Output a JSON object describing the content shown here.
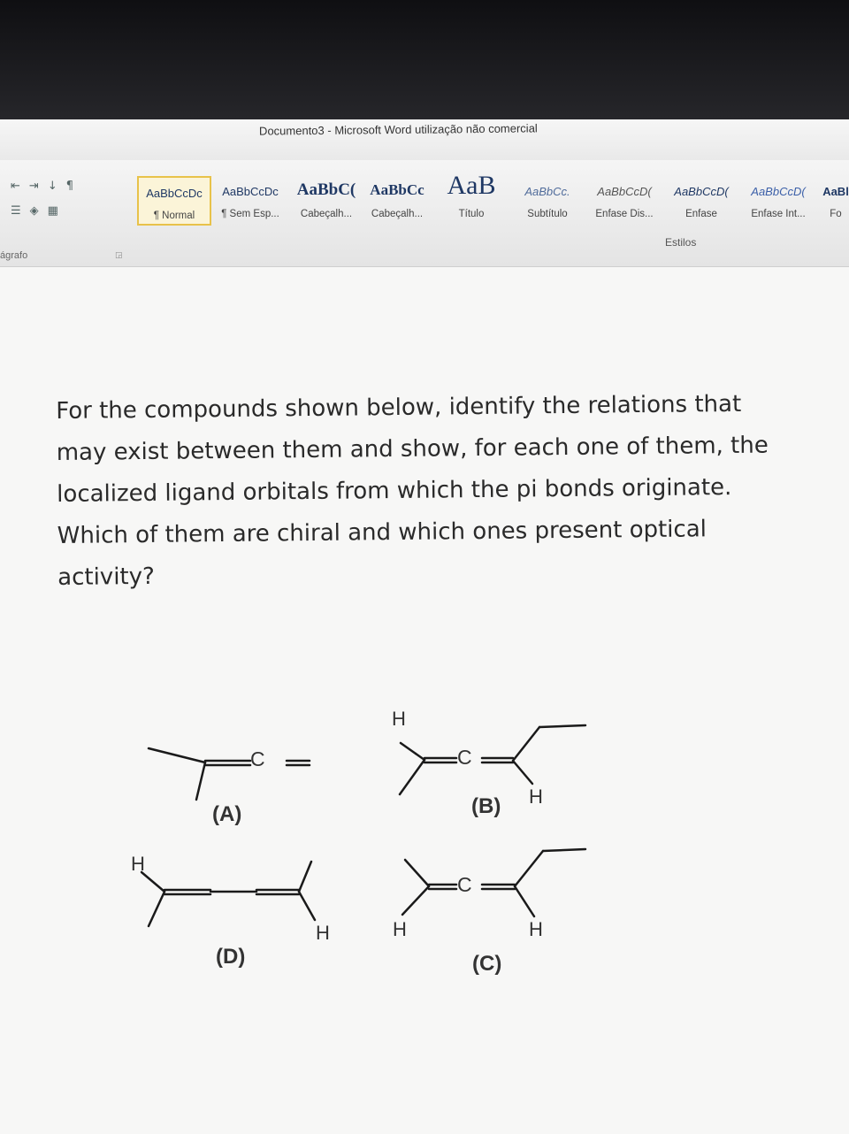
{
  "window": {
    "title": "Documento3  -  Microsoft Word utilização não comercial"
  },
  "ribbon": {
    "paragraph_group_label": "ágrafo",
    "styles_group_label": "Estilos",
    "styles": [
      {
        "sample": "AaBbCcDc",
        "name": "¶ Normal",
        "active": true
      },
      {
        "sample": "AaBbCcDc",
        "name": "¶ Sem Esp...",
        "active": false
      },
      {
        "sample": "AaBbC(",
        "name": "Cabeçalh...",
        "active": false
      },
      {
        "sample": "AaBbCc",
        "name": "Cabeçalh...",
        "active": false
      },
      {
        "sample": "AaB",
        "name": "Título",
        "active": false
      },
      {
        "sample": "AaBbCc.",
        "name": "Subtítulo",
        "active": false
      },
      {
        "sample": "AaBbCcD(",
        "name": "Ênfase Dis...",
        "active": false
      },
      {
        "sample": "AaBbCcD(",
        "name": "Ênfase",
        "active": false
      },
      {
        "sample": "AaBbCcD(",
        "name": "Ênfase Int...",
        "active": false
      },
      {
        "sample": "AaBl",
        "name": "Fo",
        "active": false
      }
    ]
  },
  "document": {
    "question": "For the compounds shown below, identify the relations that may exist between them and show, for each one of them, the localized ligand orbitals from which the pi bonds originate. Which of them are chiral and which ones present optical activity?",
    "figure": {
      "labels": {
        "a": "(A)",
        "b": "(B)",
        "c": "(C)",
        "d": "(D)"
      },
      "atoms": {
        "c": "C",
        "h": "H"
      }
    }
  }
}
